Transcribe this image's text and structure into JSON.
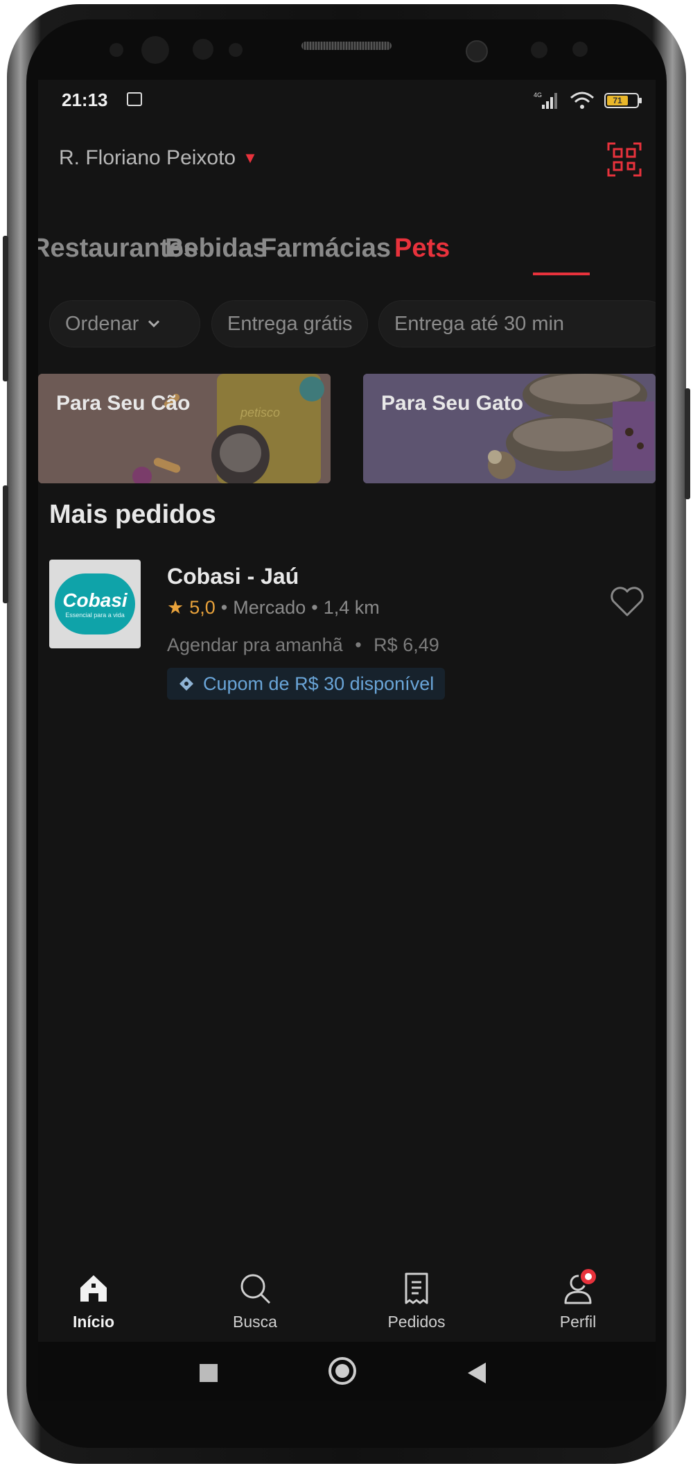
{
  "status_bar": {
    "time": "21:13",
    "network": "4G",
    "battery": "71"
  },
  "header": {
    "address": "R. Floriano Peixoto"
  },
  "tabs": [
    {
      "label": "Restaurantes"
    },
    {
      "label": "Bebidas"
    },
    {
      "label": "Farmácias"
    },
    {
      "label": "Pets"
    }
  ],
  "active_tab": "Pets",
  "filters": [
    {
      "label": "Ordenar"
    },
    {
      "label": "Entrega grátis"
    },
    {
      "label": "Entrega até 30 min"
    }
  ],
  "banners": [
    {
      "label": "Para Seu Cão",
      "decor_text": "petisco"
    },
    {
      "label": "Para Seu Gato"
    }
  ],
  "section": {
    "title": "Mais pedidos"
  },
  "store": {
    "name": "Cobasi - Jaú",
    "logo_text": "Cobasi",
    "logo_subtext": "Essencial para a vida",
    "rating": "5,0",
    "category": "Mercado",
    "distance": "1,4 km",
    "schedule": "Agendar pra amanhã",
    "fee": "R$ 6,49",
    "coupon": "Cupom de R$ 30 disponível",
    "separator": "•"
  },
  "bottom_nav": [
    {
      "label": "Início",
      "icon": "home-icon",
      "active": true
    },
    {
      "label": "Busca",
      "icon": "search-icon",
      "active": false
    },
    {
      "label": "Pedidos",
      "icon": "receipt-icon",
      "active": false
    },
    {
      "label": "Perfil",
      "icon": "profile-icon",
      "active": false
    }
  ],
  "colors": {
    "accent": "#e8323c",
    "background": "#141414",
    "coupon": "#6aa5d8",
    "rating": "#e9a23b"
  }
}
